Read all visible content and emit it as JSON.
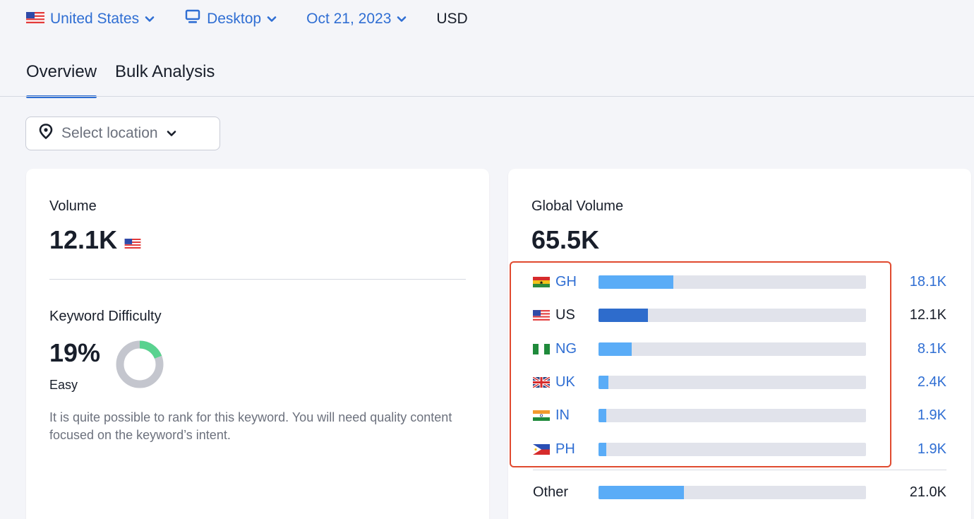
{
  "filters": {
    "country": {
      "label": "United States",
      "icon": "us-flag-icon"
    },
    "device": {
      "label": "Desktop",
      "icon": "desktop-icon"
    },
    "date": {
      "label": "Oct 21, 2023"
    },
    "currency": {
      "label": "USD"
    }
  },
  "tabs": [
    {
      "label": "Overview",
      "active": true
    },
    {
      "label": "Bulk Analysis",
      "active": false
    }
  ],
  "location": {
    "placeholder": "Select location",
    "icon": "location-pin-icon"
  },
  "volume": {
    "label": "Volume",
    "value": "12.1K"
  },
  "keyword_difficulty": {
    "label": "Keyword Difficulty",
    "value": "19%",
    "percent": 19,
    "level": "Easy",
    "description": "It is quite possible to rank for this keyword. You will need quality content focused on the keyword’s intent.",
    "colors": {
      "filled": "#59d28f",
      "empty": "#c4c6ce"
    }
  },
  "global_volume": {
    "label": "Global Volume",
    "value": "65.5K",
    "countries": [
      {
        "code": "GH",
        "value": "18.1K",
        "fraction": 0.28,
        "link": true
      },
      {
        "code": "US",
        "value": "12.1K",
        "fraction": 0.185,
        "link": false,
        "current": true
      },
      {
        "code": "NG",
        "value": "8.1K",
        "fraction": 0.124,
        "link": true
      },
      {
        "code": "UK",
        "value": "2.4K",
        "fraction": 0.037,
        "link": true
      },
      {
        "code": "IN",
        "value": "1.9K",
        "fraction": 0.029,
        "link": true
      },
      {
        "code": "PH",
        "value": "1.9K",
        "fraction": 0.029,
        "link": true
      }
    ],
    "other": {
      "label": "Other",
      "value": "21.0K",
      "fraction": 0.32
    }
  },
  "colors": {
    "link": "#2f6ed3",
    "bar": "#5aacf7",
    "bar_current": "#2e6ccc",
    "track": "#e1e3eb",
    "highlight": "#e04a2f"
  }
}
